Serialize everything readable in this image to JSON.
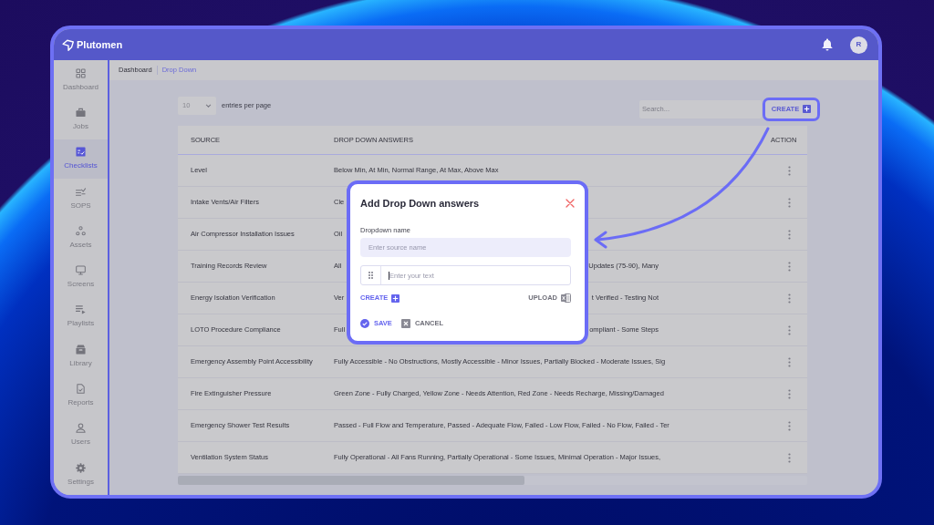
{
  "app": {
    "logo_text": "Plutomen",
    "avatar_initial": "R"
  },
  "sidebar": {
    "items": [
      {
        "label": "Dashboard",
        "selected": false
      },
      {
        "label": "Jobs",
        "selected": false
      },
      {
        "label": "Checklists",
        "selected": true
      },
      {
        "label": "SOPS",
        "selected": false
      },
      {
        "label": "Assets",
        "selected": false
      },
      {
        "label": "Screens",
        "selected": false
      },
      {
        "label": "Playlists",
        "selected": false
      },
      {
        "label": "Library",
        "selected": false
      },
      {
        "label": "Reports",
        "selected": false
      },
      {
        "label": "Users",
        "selected": false
      },
      {
        "label": "Settings",
        "selected": false
      }
    ]
  },
  "breadcrumb": [
    {
      "label": "Dashboard",
      "selected": false
    },
    {
      "label": "Drop Down",
      "selected": true
    }
  ],
  "toolbar": {
    "page_size": "10",
    "page_size_label": "entries per page",
    "search": {
      "placeholder": "Search..."
    },
    "create_button": {
      "label": "CREATE",
      "highlighted": true
    }
  },
  "table": {
    "columns": [
      "SOURCE",
      "DROP DOWN ANSWERS",
      "ACTION"
    ],
    "rows": [
      {
        "source": "Level",
        "answers": [
          "Below Min, At Min, Normal Range, At Max, Above Max"
        ]
      },
      {
        "source": "Intake Vents/Air Filters",
        "answers": [
          "Cle"
        ]
      },
      {
        "source": "Air Compressor Installation Issues",
        "answers": [
          "Oil"
        ]
      },
      {
        "source": "Training Records Review",
        "answers": [
          "All",
          "Updates (75-90), Many"
        ]
      },
      {
        "source": "Energy Isolation Verification",
        "answers": [
          "Ver",
          "t Verified - Testing Not"
        ]
      },
      {
        "source": "LOTO Procedure Compliance",
        "answers": [
          "Full",
          "ompliant - Some Steps"
        ]
      },
      {
        "source": "Emergency Assembly Point Accessibility",
        "answers": [
          "Fully Accessible - No Obstructions, Mostly Accessible - Minor Issues, Partially Blocked - Moderate Issues, Sig"
        ]
      },
      {
        "source": "Fire Extinguisher Pressure",
        "answers": [
          "Green Zone - Fully Charged, Yellow Zone - Needs Attention, Red Zone - Needs Recharge, Missing/Damaged"
        ]
      },
      {
        "source": "Emergency Shower Test Results",
        "answers": [
          "Passed - Full Flow and Temperature, Passed - Adequate Flow, Failed - Low Flow, Failed - No Flow, Failed - Ter"
        ]
      },
      {
        "source": "Ventilation System Status",
        "answers": [
          "Fully Operational - All Fans Running, Partially Operational - Some Issues, Minimal Operation - Major Issues,"
        ]
      }
    ]
  },
  "modal": {
    "title": "Add Drop Down answers",
    "field_label": "Dropdown name",
    "name_field": {
      "placeholder": "Enter source name"
    },
    "answer_field": {
      "placeholder": "Enter your text",
      "focused": true
    },
    "create_label": "CREATE",
    "upload_label": "UPLOAD",
    "save_label": "SAVE",
    "cancel_label": "CANCEL"
  }
}
